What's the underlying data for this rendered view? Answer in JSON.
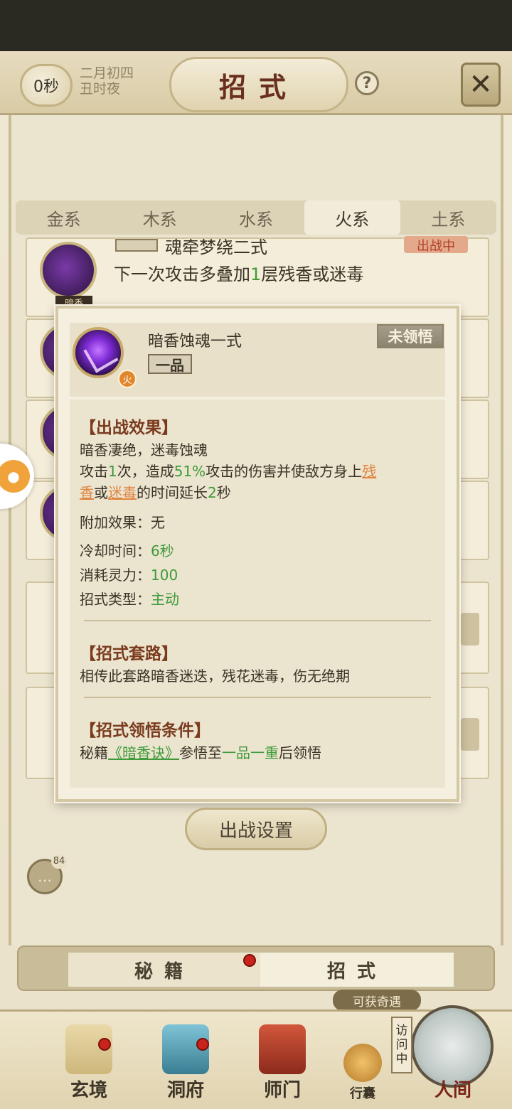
{
  "header": {
    "timer": "0秒",
    "date_line1": "二月初四",
    "date_line2": "丑时夜",
    "title": "招式",
    "help": "?"
  },
  "tabs": [
    "金系",
    "木系",
    "水系",
    "火系",
    "土系"
  ],
  "active_tab": "火系",
  "bg_card": {
    "name": "魂牵梦绕二式",
    "desc_pre": "下一次攻击多叠加",
    "desc_num": "1",
    "desc_post": "层残香或迷毒",
    "icon_tag": "暗香",
    "badge": "出战中"
  },
  "popup": {
    "skill_name": "暗香蚀魂一式",
    "grade": "一品",
    "element": "火",
    "status": "未领悟",
    "effect_title": "【出战效果】",
    "effect_line1": "暗香凄绝，迷毒蚀魂",
    "effect_a": "攻击",
    "effect_hits": "1",
    "effect_b": "次，造成",
    "effect_pct": "51%",
    "effect_c": "攻击的伤害并使敌方身上",
    "effect_link1_a": "残",
    "effect_link1_b": "香",
    "effect_or": "或",
    "effect_link2": "迷毒",
    "effect_d": "的时间延长",
    "effect_secs": "2",
    "effect_e": "秒",
    "extra_label": "附加效果：",
    "extra_value": "无",
    "cooldown_label": "冷却时间：",
    "cooldown_value": "6秒",
    "cost_label": "消耗灵力：",
    "cost_value": "100",
    "type_label": "招式类型：",
    "type_value": "主动",
    "routine_title": "【招式套路】",
    "routine_text": "相传此套路暗香迷迭，残花迷毒，伤无绝期",
    "cond_title": "【招式领悟条件】",
    "cond_a": "秘籍",
    "cond_book": "《暗香诀》",
    "cond_b": "参悟至",
    "cond_level": "一品一重",
    "cond_c": "后领悟"
  },
  "deploy_button": "出战设置",
  "chat_count": "84",
  "sub_tabs": {
    "left": "秘籍",
    "right": "招式"
  },
  "chance_label": "可获奇遇",
  "visiting_label": "访问中",
  "nav": {
    "xuanjing": "玄境",
    "dongfu": "洞府",
    "shimen": "师门",
    "xingnang": "行囊",
    "renjian": "人间"
  },
  "colors": {
    "accent_green": "#3f9a3a",
    "link_orange": "#e0843e",
    "section_title": "#7a3b1e"
  }
}
